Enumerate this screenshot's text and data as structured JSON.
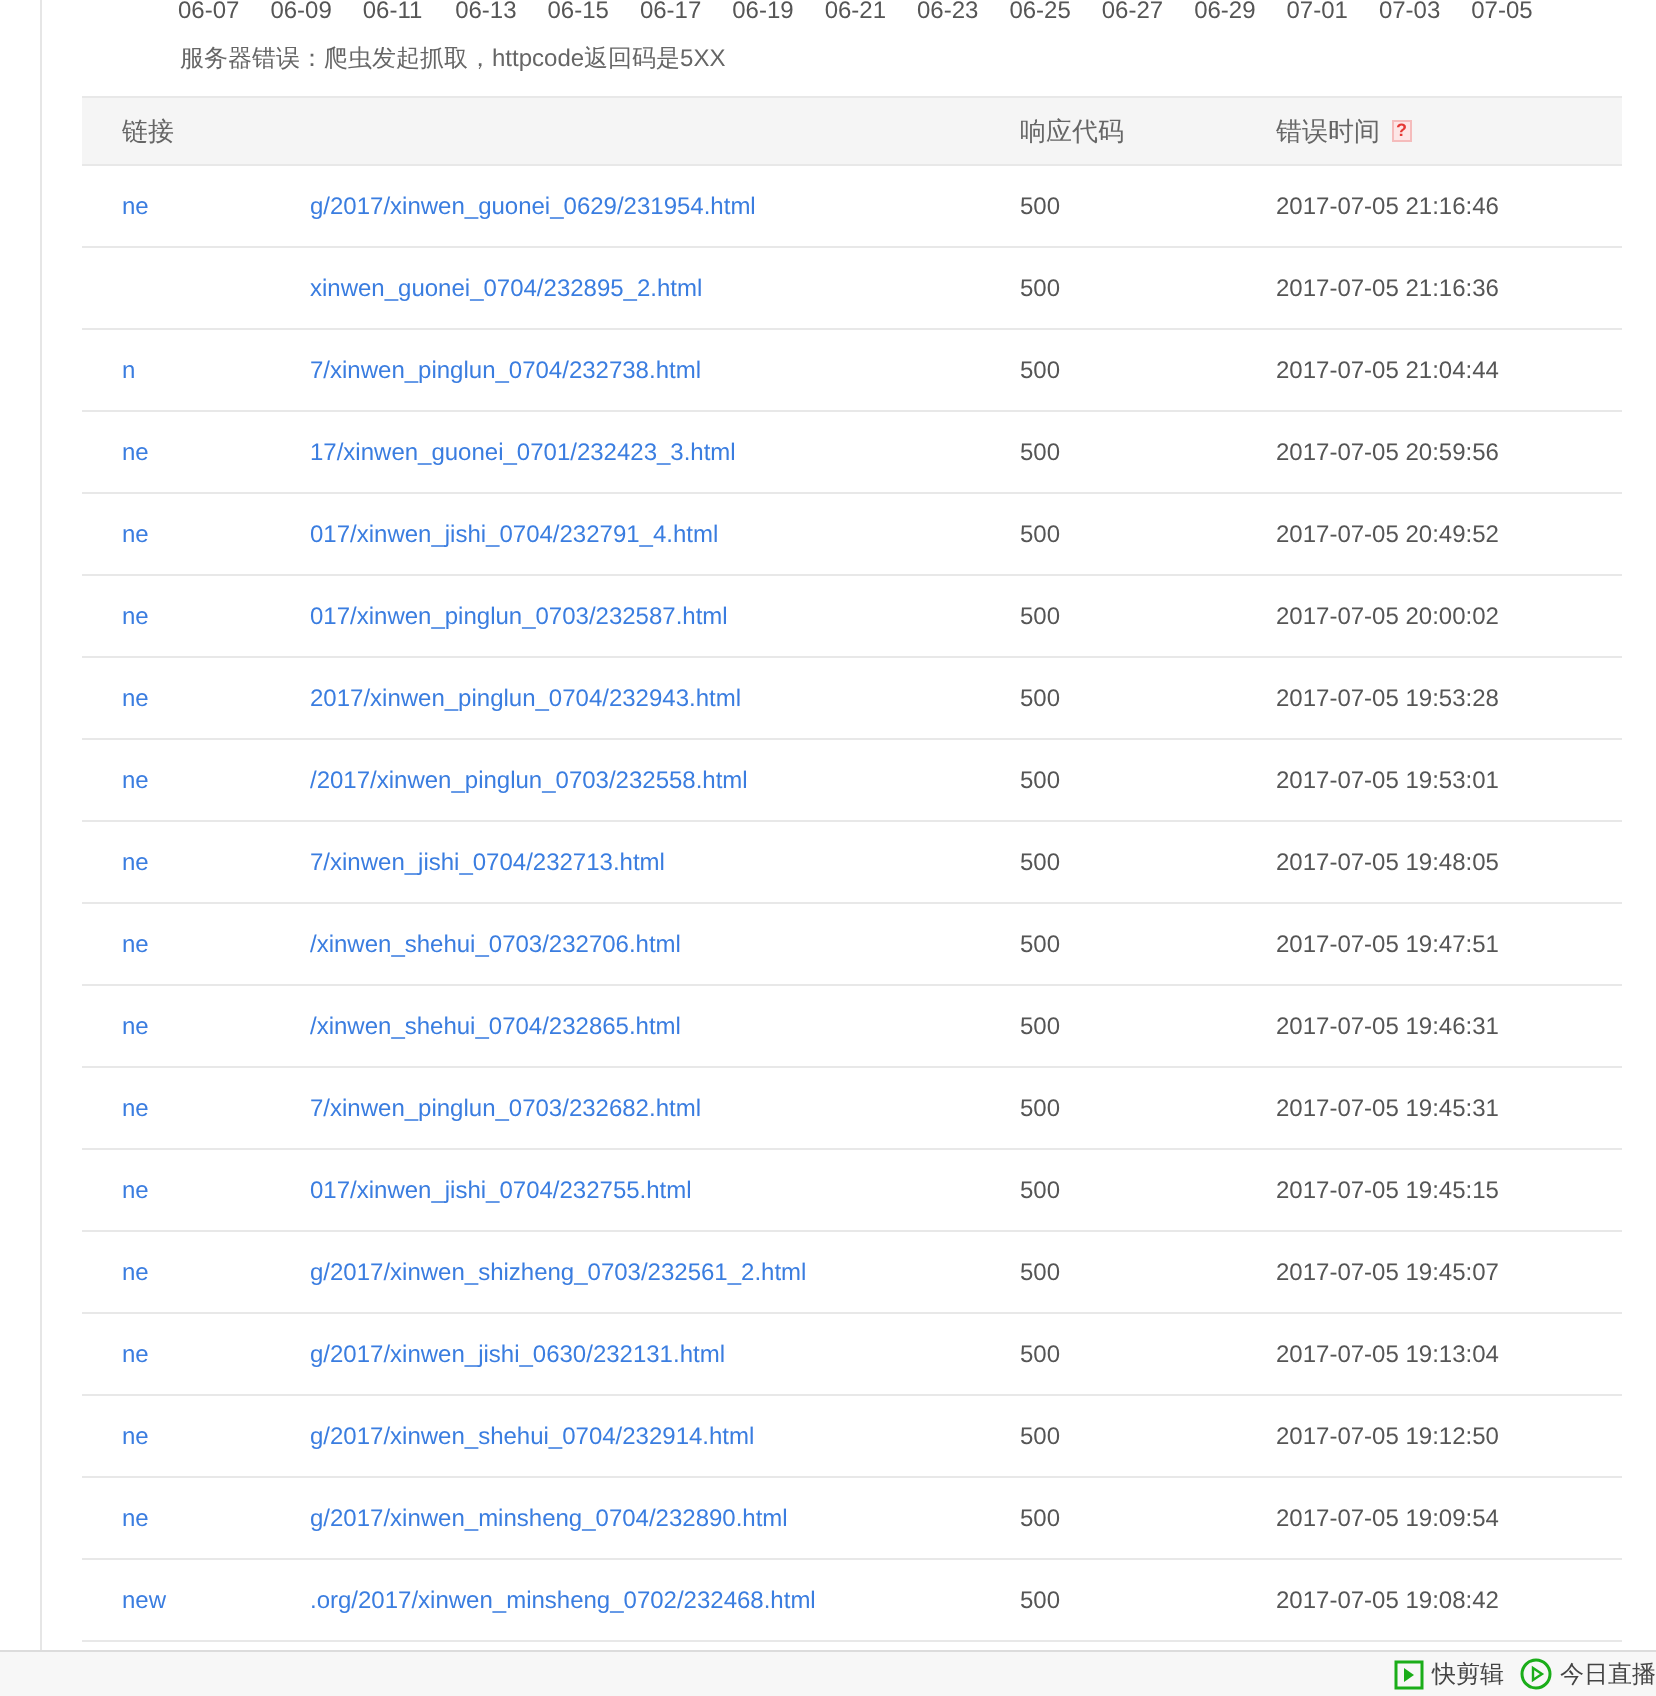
{
  "axis_labels": [
    "06-07",
    "06-09",
    "06-11",
    "06-13",
    "06-15",
    "06-17",
    "06-19",
    "06-21",
    "06-23",
    "06-25",
    "06-27",
    "06-29",
    "07-01",
    "07-03",
    "07-05"
  ],
  "note": "服务器错误：爬虫发起抓取，httpcode返回码是5XX",
  "table": {
    "columns": [
      {
        "label": "链接"
      },
      {
        "label": "响应代码"
      },
      {
        "label": "错误时间",
        "help": "?"
      }
    ],
    "rows": [
      {
        "link_prefix": "ne",
        "link_suffix": "g/2017/xinwen_guonei_0629/231954.html",
        "code": "500",
        "time": "2017-07-05 21:16:46"
      },
      {
        "link_prefix": "",
        "link_suffix": "xinwen_guonei_0704/232895_2.html",
        "code": "500",
        "time": "2017-07-05 21:16:36"
      },
      {
        "link_prefix": "n",
        "link_suffix": "7/xinwen_pinglun_0704/232738.html",
        "code": "500",
        "time": "2017-07-05 21:04:44"
      },
      {
        "link_prefix": "ne",
        "link_suffix": "17/xinwen_guonei_0701/232423_3.html",
        "code": "500",
        "time": "2017-07-05 20:59:56"
      },
      {
        "link_prefix": "ne",
        "link_suffix": "017/xinwen_jishi_0704/232791_4.html",
        "code": "500",
        "time": "2017-07-05 20:49:52"
      },
      {
        "link_prefix": "ne",
        "link_suffix": "017/xinwen_pinglun_0703/232587.html",
        "code": "500",
        "time": "2017-07-05 20:00:02"
      },
      {
        "link_prefix": "ne",
        "link_suffix": "2017/xinwen_pinglun_0704/232943.html",
        "code": "500",
        "time": "2017-07-05 19:53:28"
      },
      {
        "link_prefix": "ne",
        "link_suffix": "/2017/xinwen_pinglun_0703/232558.html",
        "code": "500",
        "time": "2017-07-05 19:53:01"
      },
      {
        "link_prefix": "ne",
        "link_suffix": "7/xinwen_jishi_0704/232713.html",
        "code": "500",
        "time": "2017-07-05 19:48:05"
      },
      {
        "link_prefix": "ne",
        "link_suffix": "/xinwen_shehui_0703/232706.html",
        "code": "500",
        "time": "2017-07-05 19:47:51"
      },
      {
        "link_prefix": "ne",
        "link_suffix": "/xinwen_shehui_0704/232865.html",
        "code": "500",
        "time": "2017-07-05 19:46:31"
      },
      {
        "link_prefix": "ne",
        "link_suffix": "7/xinwen_pinglun_0703/232682.html",
        "code": "500",
        "time": "2017-07-05 19:45:31"
      },
      {
        "link_prefix": "ne",
        "link_suffix": "017/xinwen_jishi_0704/232755.html",
        "code": "500",
        "time": "2017-07-05 19:45:15"
      },
      {
        "link_prefix": "ne",
        "link_suffix": "g/2017/xinwen_shizheng_0703/232561_2.html",
        "code": "500",
        "time": "2017-07-05 19:45:07"
      },
      {
        "link_prefix": "ne",
        "link_suffix": "g/2017/xinwen_jishi_0630/232131.html",
        "code": "500",
        "time": "2017-07-05 19:13:04"
      },
      {
        "link_prefix": "ne",
        "link_suffix": "g/2017/xinwen_shehui_0704/232914.html",
        "code": "500",
        "time": "2017-07-05 19:12:50"
      },
      {
        "link_prefix": "ne",
        "link_suffix": "g/2017/xinwen_minsheng_0704/232890.html",
        "code": "500",
        "time": "2017-07-05 19:09:54"
      },
      {
        "link_prefix": "new",
        "link_suffix": ".org/2017/xinwen_minsheng_0702/232468.html",
        "code": "500",
        "time": "2017-07-05 19:08:42"
      }
    ]
  },
  "status_bar": {
    "items": [
      {
        "kind": "square",
        "label": "快剪辑"
      },
      {
        "kind": "circle",
        "label": "今日直播"
      }
    ]
  }
}
